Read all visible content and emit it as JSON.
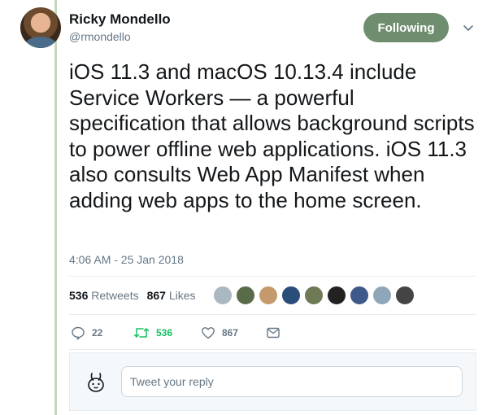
{
  "tweet": {
    "author_name": "Ricky Mondello",
    "author_handle": "@rmondello",
    "follow_label": "Following",
    "text": "iOS 11.3 and macOS 10.13.4 include Service Workers — a powerful specification that allows background scripts to power offline web applications. iOS 11.3 also consults Web App Manifest when adding web apps to the home screen.",
    "timestamp": "4:06 AM - 25 Jan 2018"
  },
  "stats": {
    "retweets_count": "536",
    "retweets_label": "Retweets",
    "likes_count": "867",
    "likes_label": "Likes"
  },
  "actions": {
    "reply_count": "22",
    "retweet_count": "536",
    "like_count": "867"
  },
  "reply": {
    "placeholder": "Tweet your reply"
  },
  "colors": {
    "follow_button": "#6f8e6f",
    "thread_line": "#c5d8bd",
    "retweet_active": "#17bf63",
    "secondary_text": "#657786"
  },
  "icons": [
    "caret-down-icon",
    "reply-icon",
    "retweet-icon",
    "like-icon",
    "direct-message-icon",
    "egg-avatar-icon"
  ]
}
